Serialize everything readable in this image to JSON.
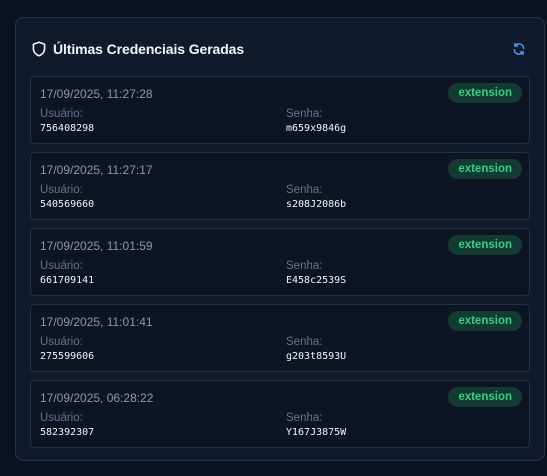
{
  "panel": {
    "title": "Últimas Credenciais Geradas",
    "icons": {
      "title_icon": "shield-icon",
      "action_icon": "refresh-icon"
    },
    "user_label": "Usuário:",
    "password_label": "Senha:",
    "colors": {
      "accent": "#4ea1f3",
      "badge_bg": "#133a33",
      "badge_text": "#34d07f"
    }
  },
  "credentials": [
    {
      "timestamp": "17/09/2025, 11:27:28",
      "source": "extension",
      "user": "756408298",
      "password": "m659x9846g"
    },
    {
      "timestamp": "17/09/2025, 11:27:17",
      "source": "extension",
      "user": "540569660",
      "password": "s208J2086b"
    },
    {
      "timestamp": "17/09/2025, 11:01:59",
      "source": "extension",
      "user": "661709141",
      "password": "E458c2539S"
    },
    {
      "timestamp": "17/09/2025, 11:01:41",
      "source": "extension",
      "user": "275599606",
      "password": "g203t8593U"
    },
    {
      "timestamp": "17/09/2025, 06:28:22",
      "source": "extension",
      "user": "582392307",
      "password": "Y167J3875W"
    }
  ]
}
